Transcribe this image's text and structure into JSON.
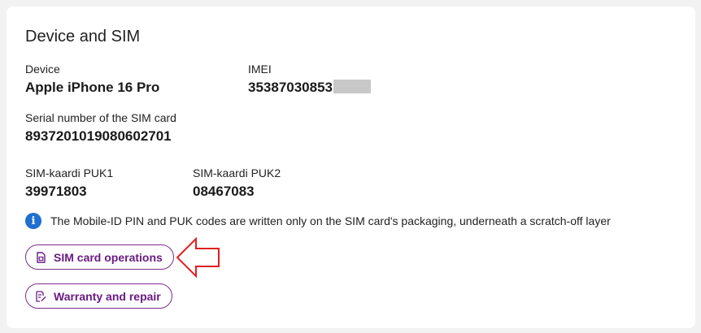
{
  "section": {
    "title": "Device and SIM"
  },
  "fields": {
    "device_label": "Device",
    "device_value": "Apple iPhone 16 Pro",
    "imei_label": "IMEI",
    "imei_value_visible": "35387030853",
    "serial_label": "Serial number of the SIM card",
    "serial_value": "8937201019080602701",
    "puk1_label": "SIM-kaardi PUK1",
    "puk1_value": "39971803",
    "puk2_label": "SIM-kaardi PUK2",
    "puk2_value": "08467083"
  },
  "info": {
    "icon": "info-icon",
    "text": "The Mobile-ID PIN and PUK codes are written only on the SIM card's packaging, underneath a scratch-off layer"
  },
  "actions": {
    "sim_operations_label": "SIM card operations",
    "sim_operations_icon": "sim-card-icon",
    "warranty_label": "Warranty and repair",
    "warranty_icon": "edit-document-icon"
  },
  "colors": {
    "accent": "#7b2d8f",
    "info_blue": "#1e6fd0",
    "annotation_red": "#e02020",
    "redaction_gray": "#c8c8c8"
  }
}
